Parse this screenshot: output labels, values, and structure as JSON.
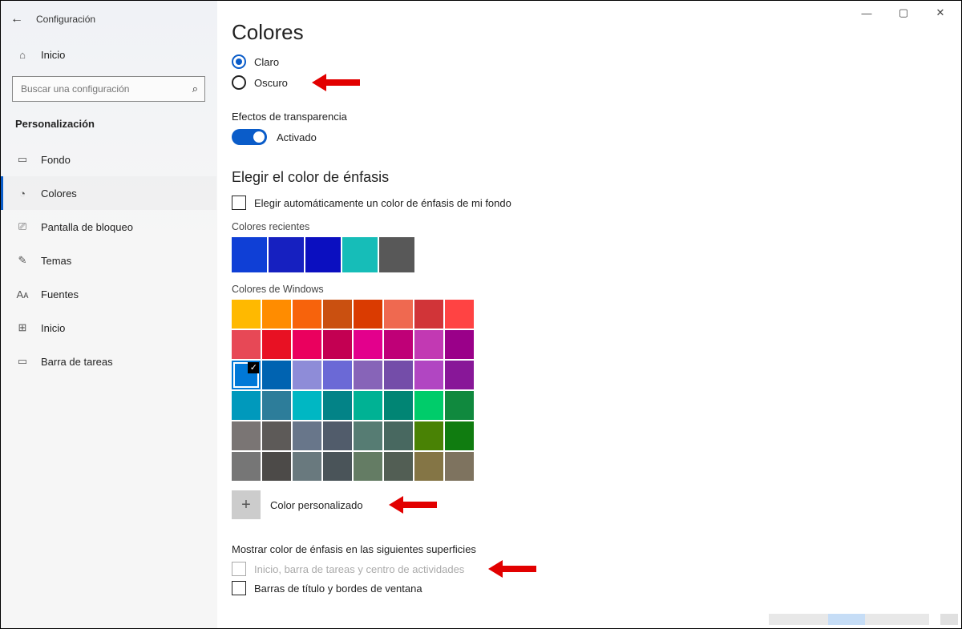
{
  "window": {
    "minimize": "—",
    "maximize": "▢",
    "close": "✕"
  },
  "sidebar": {
    "back_glyph": "←",
    "title": "Configuración",
    "home_label": "Inicio",
    "search_placeholder": "Buscar una configuración",
    "search_icon": "⌕",
    "section": "Personalización",
    "items": [
      {
        "icon": "▭",
        "label": "Fondo"
      },
      {
        "icon": "◔",
        "label": "Colores"
      },
      {
        "icon": "⎚",
        "label": "Pantalla de bloqueo"
      },
      {
        "icon": "✎",
        "label": "Temas"
      },
      {
        "icon": "Aᴀ",
        "label": "Fuentes"
      },
      {
        "icon": "⊞",
        "label": "Inicio"
      },
      {
        "icon": "▭",
        "label": "Barra de tareas"
      }
    ]
  },
  "content": {
    "page_title": "Colores",
    "radio_light": "Claro",
    "radio_dark": "Oscuro",
    "transparency_label": "Efectos de transparencia",
    "transparency_state": "Activado",
    "accent_heading": "Elegir el color de énfasis",
    "auto_accent_label": "Elegir automáticamente un color de énfasis de mi fondo",
    "recent_label": "Colores recientes",
    "recent_colors": [
      "#0f3fd6",
      "#1620c0",
      "#0b0fc0",
      "#16bdb8",
      "#585858"
    ],
    "windows_label": "Colores de Windows",
    "windows_colors": [
      "#ffb900",
      "#ff8c00",
      "#f7630c",
      "#ca5010",
      "#da3b01",
      "#ef6950",
      "#d13438",
      "#ff4343",
      "#e74856",
      "#e81123",
      "#ea005e",
      "#c30052",
      "#e3008c",
      "#bf0077",
      "#c239b3",
      "#9a0089",
      "#0078d7",
      "#0063b1",
      "#8e8cd8",
      "#6b69d6",
      "#8764b8",
      "#744da9",
      "#b146c2",
      "#881798",
      "#0099bc",
      "#2d7d9a",
      "#00b7c3",
      "#038387",
      "#00b294",
      "#018574",
      "#00cc6a",
      "#10893e",
      "#7a7574",
      "#5d5a58",
      "#68768a",
      "#515c6b",
      "#567c73",
      "#486860",
      "#498205",
      "#107c10",
      "#767676",
      "#4c4a48",
      "#69797e",
      "#4a5459",
      "#647c64",
      "#525e54",
      "#847545",
      "#7e735f"
    ],
    "selected_index": 16,
    "custom_color_label": "Color personalizado",
    "surfaces_heading": "Mostrar color de énfasis en las siguientes superficies",
    "surface_start": "Inicio, barra de tareas y centro de actividades",
    "surface_titlebars": "Barras de título y bordes de ventana"
  }
}
